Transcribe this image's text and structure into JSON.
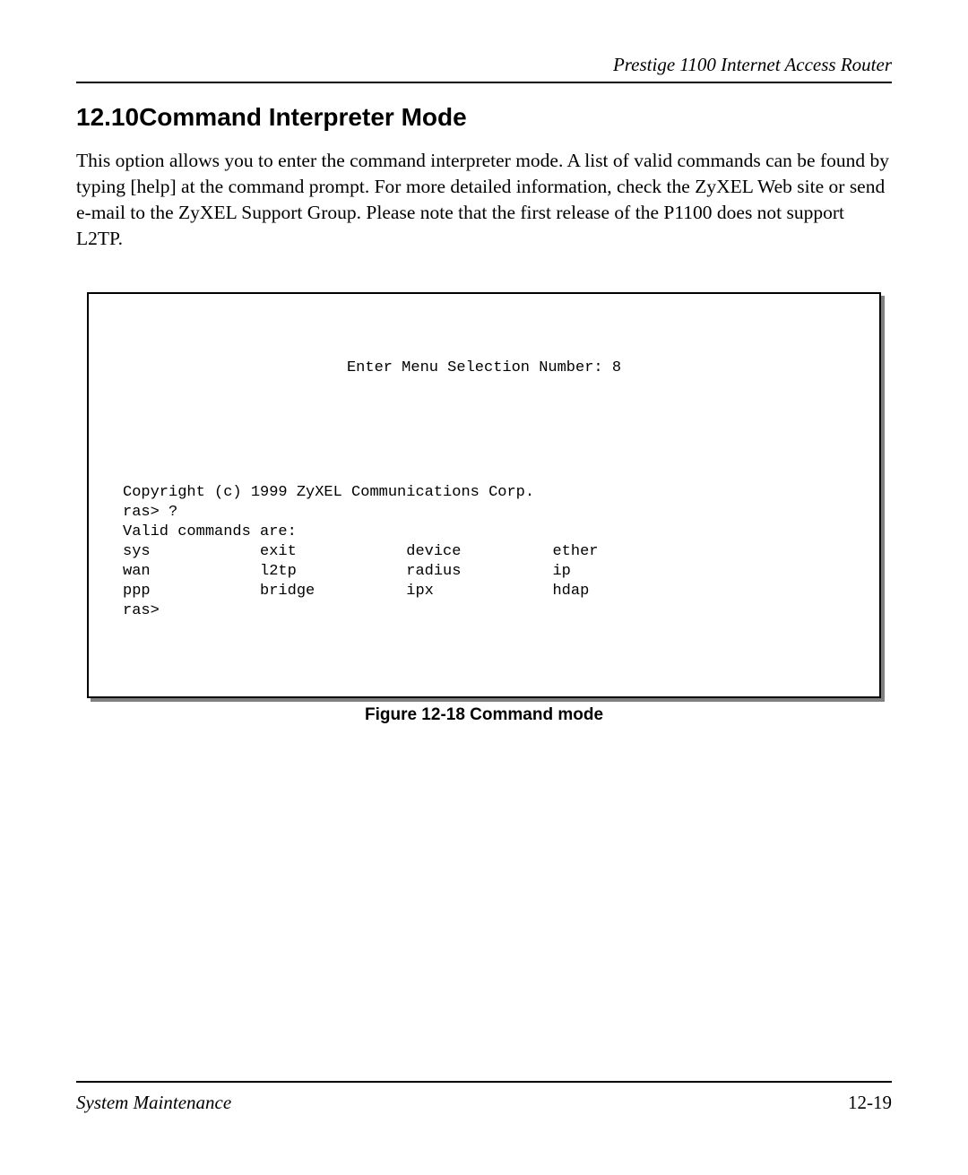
{
  "header": {
    "product_title": "Prestige 1100 Internet Access Router"
  },
  "section": {
    "number": "12.10",
    "title": "Command Interpreter Mode"
  },
  "body_paragraph": "This option allows you to enter the command interpreter mode. A list of valid commands can be found by typing [help] at the command prompt. For more detailed information, check the ZyXEL Web site or send e-mail to the ZyXEL Support Group. Please note that the first release of the P1100 does not support L2TP.",
  "terminal": {
    "menu_line": "Enter Menu Selection Number: 8",
    "copyright": "Copyright (c) 1999 ZyXEL Communications Corp.",
    "prompt1": "ras> ?",
    "valid_label": "Valid commands are:",
    "row1": "sys            exit            device          ether",
    "row2": "wan            l2tp            radius          ip",
    "row3": "ppp            bridge          ipx             hdap",
    "prompt2": "ras>"
  },
  "figure_caption": "Figure 12-18 Command mode",
  "footer": {
    "left": "System Maintenance",
    "right": "12-19"
  }
}
